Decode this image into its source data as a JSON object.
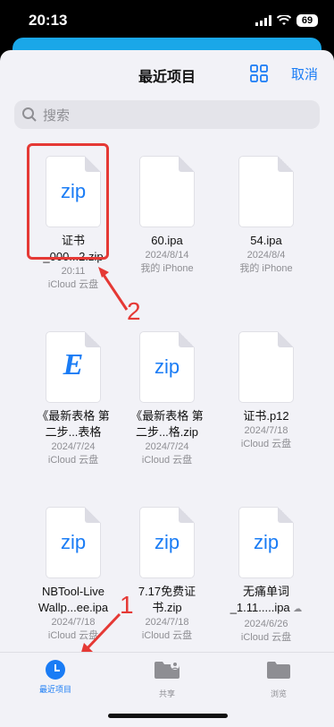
{
  "status": {
    "time": "20:13",
    "battery": "69"
  },
  "header": {
    "title": "最近项目",
    "cancel": "取消"
  },
  "search": {
    "placeholder": "搜索"
  },
  "files": [
    {
      "thumb": "zip",
      "name1": "证书",
      "name2": "_000...2.zip",
      "meta1": "20:11",
      "meta2": "iCloud 云盘"
    },
    {
      "thumb": "blank",
      "name1": "60.ipa",
      "name2": "",
      "meta1": "2024/8/14",
      "meta2": "我的 iPhone"
    },
    {
      "thumb": "blank",
      "name1": "54.ipa",
      "name2": "",
      "meta1": "2024/8/4",
      "meta2": "我的 iPhone"
    },
    {
      "thumb": "E",
      "name1": "《最新表格 第",
      "name2": "二步...表格",
      "meta1": "2024/7/24",
      "meta2": "iCloud 云盘"
    },
    {
      "thumb": "zip",
      "name1": "《最新表格 第",
      "name2": "二步...格.zip",
      "meta1": "2024/7/24",
      "meta2": "iCloud 云盘"
    },
    {
      "thumb": "blank",
      "name1": "证书.p12",
      "name2": "",
      "meta1": "2024/7/18",
      "meta2": "iCloud 云盘"
    },
    {
      "thumb": "zip",
      "name1": "NBTool-Live",
      "name2": "Wallp...ee.ipa",
      "meta1": "2024/7/18",
      "meta2": "iCloud 云盘"
    },
    {
      "thumb": "zip",
      "name1": "7.17免费证",
      "name2": "书.zip",
      "meta1": "2024/7/18",
      "meta2": "iCloud 云盘"
    },
    {
      "thumb": "zip",
      "name1": "无痛单词",
      "name2": "_1.11.....ipa",
      "meta1": "2024/6/26",
      "meta2": "iCloud 云盘"
    }
  ],
  "annotations": {
    "one": "1",
    "two": "2"
  },
  "tabs": {
    "recent": "最近项目",
    "shared": "共享",
    "browse": "浏览"
  },
  "colors": {
    "accent": "#1a7cf5",
    "annotation": "#e53935"
  }
}
